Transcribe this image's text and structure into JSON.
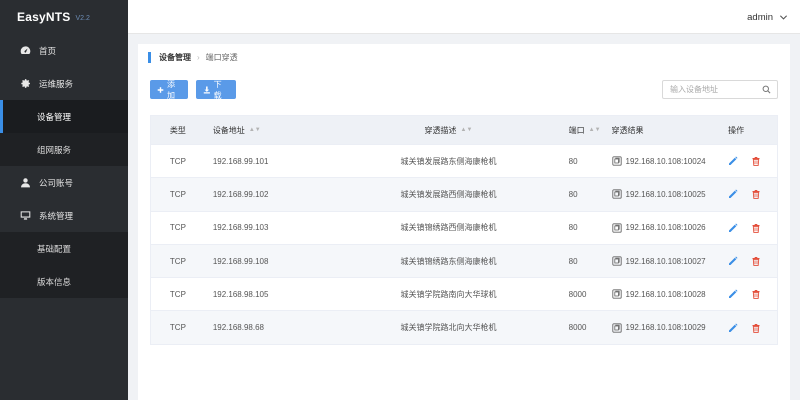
{
  "brand": {
    "name": "EasyNTS",
    "version": "V2.2"
  },
  "sidebar": {
    "items": [
      {
        "label": "首页",
        "icon": "dashboard-icon"
      },
      {
        "label": "运维服务",
        "icon": "gear-icon"
      },
      {
        "label": "设备管理",
        "sub": true,
        "active": true
      },
      {
        "label": "组网服务",
        "sub": true
      },
      {
        "label": "公司账号",
        "icon": "user-icon"
      },
      {
        "label": "系统管理",
        "icon": "monitor-icon"
      },
      {
        "label": "基础配置",
        "sub": true
      },
      {
        "label": "版本信息",
        "sub": true
      }
    ]
  },
  "header": {
    "user": "admin"
  },
  "breadcrumb": {
    "parent": "设备管理",
    "current": "端口穿透"
  },
  "toolbar": {
    "add_label": "添加",
    "download_label": "下载"
  },
  "search": {
    "placeholder": "输入设备地址",
    "value": ""
  },
  "table": {
    "columns": [
      "类型",
      "设备地址",
      "穿透描述",
      "端口",
      "穿透结果",
      "操作"
    ],
    "rows": [
      {
        "type": "TCP",
        "addr": "192.168.99.101",
        "desc": "城关镇发展路东侧海康枪机",
        "port": "80",
        "result": "192.168.10.108:10024"
      },
      {
        "type": "TCP",
        "addr": "192.168.99.102",
        "desc": "城关镇发展路西侧海康枪机",
        "port": "80",
        "result": "192.168.10.108:10025"
      },
      {
        "type": "TCP",
        "addr": "192.168.99.103",
        "desc": "城关镇锦绣路西侧海康枪机",
        "port": "80",
        "result": "192.168.10.108:10026"
      },
      {
        "type": "TCP",
        "addr": "192.168.99.108",
        "desc": "城关镇锦绣路东侧海康枪机",
        "port": "80",
        "result": "192.168.10.108:10027"
      },
      {
        "type": "TCP",
        "addr": "192.168.98.105",
        "desc": "城关镇学院路南向大华球机",
        "port": "8000",
        "result": "192.168.10.108:10028"
      },
      {
        "type": "TCP",
        "addr": "192.168.98.68",
        "desc": "城关镇学院路北向大华枪机",
        "port": "8000",
        "result": "192.168.10.108:10029"
      }
    ]
  },
  "colors": {
    "accent": "#3a8ee6",
    "sidebar_bg": "#2a2d31",
    "button": "#5a9ae8",
    "edit": "#3a8ee6",
    "delete": "#e4503c"
  }
}
